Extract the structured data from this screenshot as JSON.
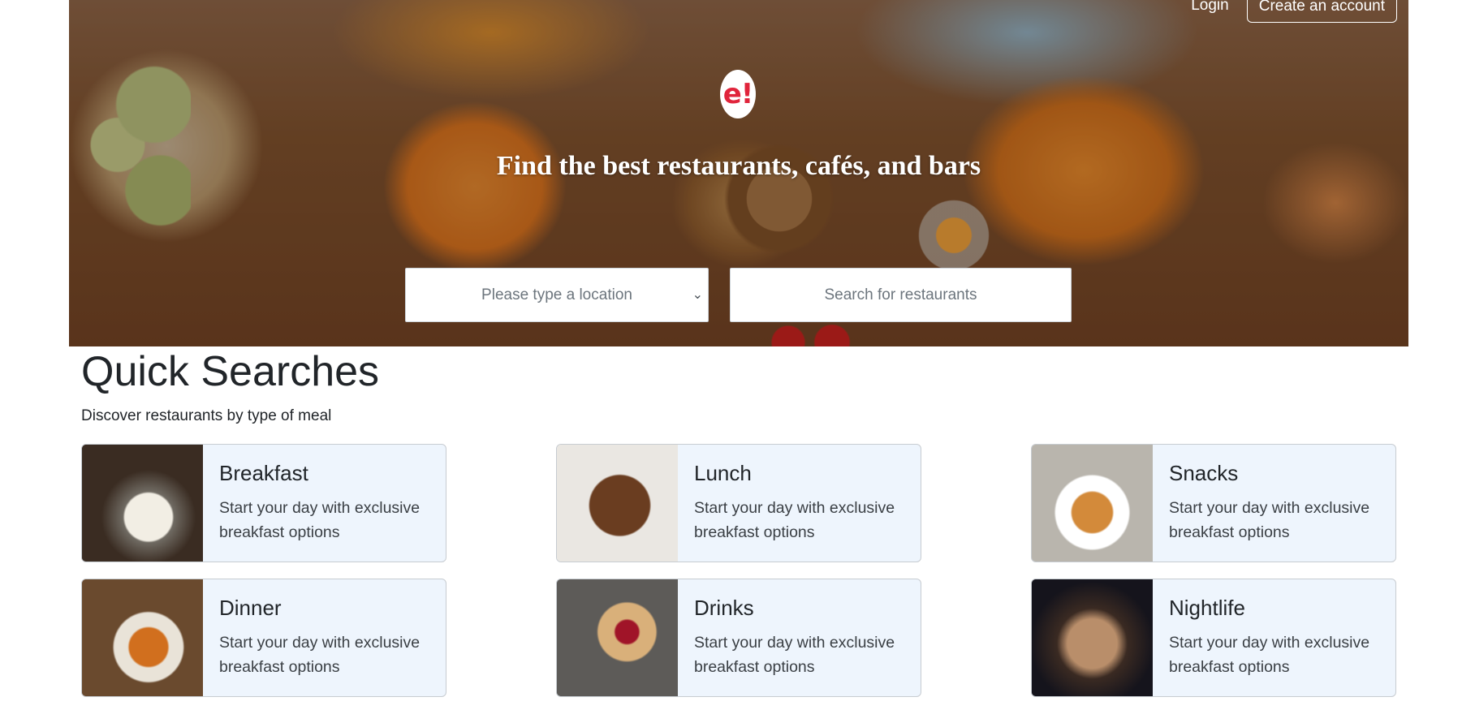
{
  "header": {
    "login_label": "Login",
    "create_account_label": "Create an account",
    "logo_text": "e!",
    "title": "Find the best restaurants, cafés, and bars"
  },
  "search": {
    "location_placeholder": "Please type a location",
    "restaurant_placeholder": "Search for restaurants"
  },
  "quick_searches": {
    "title": "Quick Searches",
    "subtitle": "Discover restaurants by type of meal",
    "items": [
      {
        "title": "Breakfast",
        "description": "Start your day with exclusive breakfast options",
        "image_icon": "breakfast-image"
      },
      {
        "title": "Lunch",
        "description": "Start your day with exclusive breakfast options",
        "image_icon": "lunch-image"
      },
      {
        "title": "Snacks",
        "description": "Start your day with exclusive breakfast options",
        "image_icon": "snacks-image"
      },
      {
        "title": "Dinner",
        "description": "Start your day with exclusive breakfast options",
        "image_icon": "dinner-image"
      },
      {
        "title": "Drinks",
        "description": "Start your day with exclusive breakfast options",
        "image_icon": "drinks-image"
      },
      {
        "title": "Nightlife",
        "description": "Start your day with exclusive breakfast options",
        "image_icon": "nightlife-image"
      }
    ]
  },
  "colors": {
    "brand_red": "#e0243b",
    "card_bg": "#eef5fd",
    "card_border": "#c7ccd1"
  }
}
